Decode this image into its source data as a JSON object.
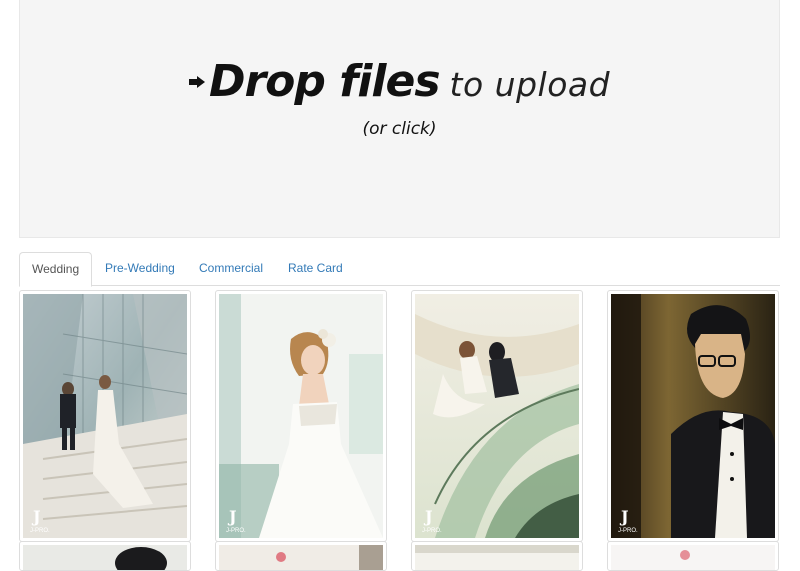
{
  "dropzone": {
    "title_strong": "Drop files",
    "title_light": "to upload",
    "subtitle": "(or click)"
  },
  "tabs": [
    {
      "label": "Wedding",
      "active": true
    },
    {
      "label": "Pre-Wedding",
      "active": false
    },
    {
      "label": "Commercial",
      "active": false
    },
    {
      "label": "Rate Card",
      "active": false
    }
  ],
  "gallery": {
    "watermark": "J-PRO.",
    "photos": [
      {
        "subject": "couple on glass staircase"
      },
      {
        "subject": "bride in white gown"
      },
      {
        "subject": "couple embracing on spiral stairs"
      },
      {
        "subject": "groom in tuxedo by window"
      }
    ]
  },
  "colors": {
    "link": "#337ab7",
    "active_tab_text": "#555555",
    "dropzone_bg": "#f5f5f5"
  }
}
